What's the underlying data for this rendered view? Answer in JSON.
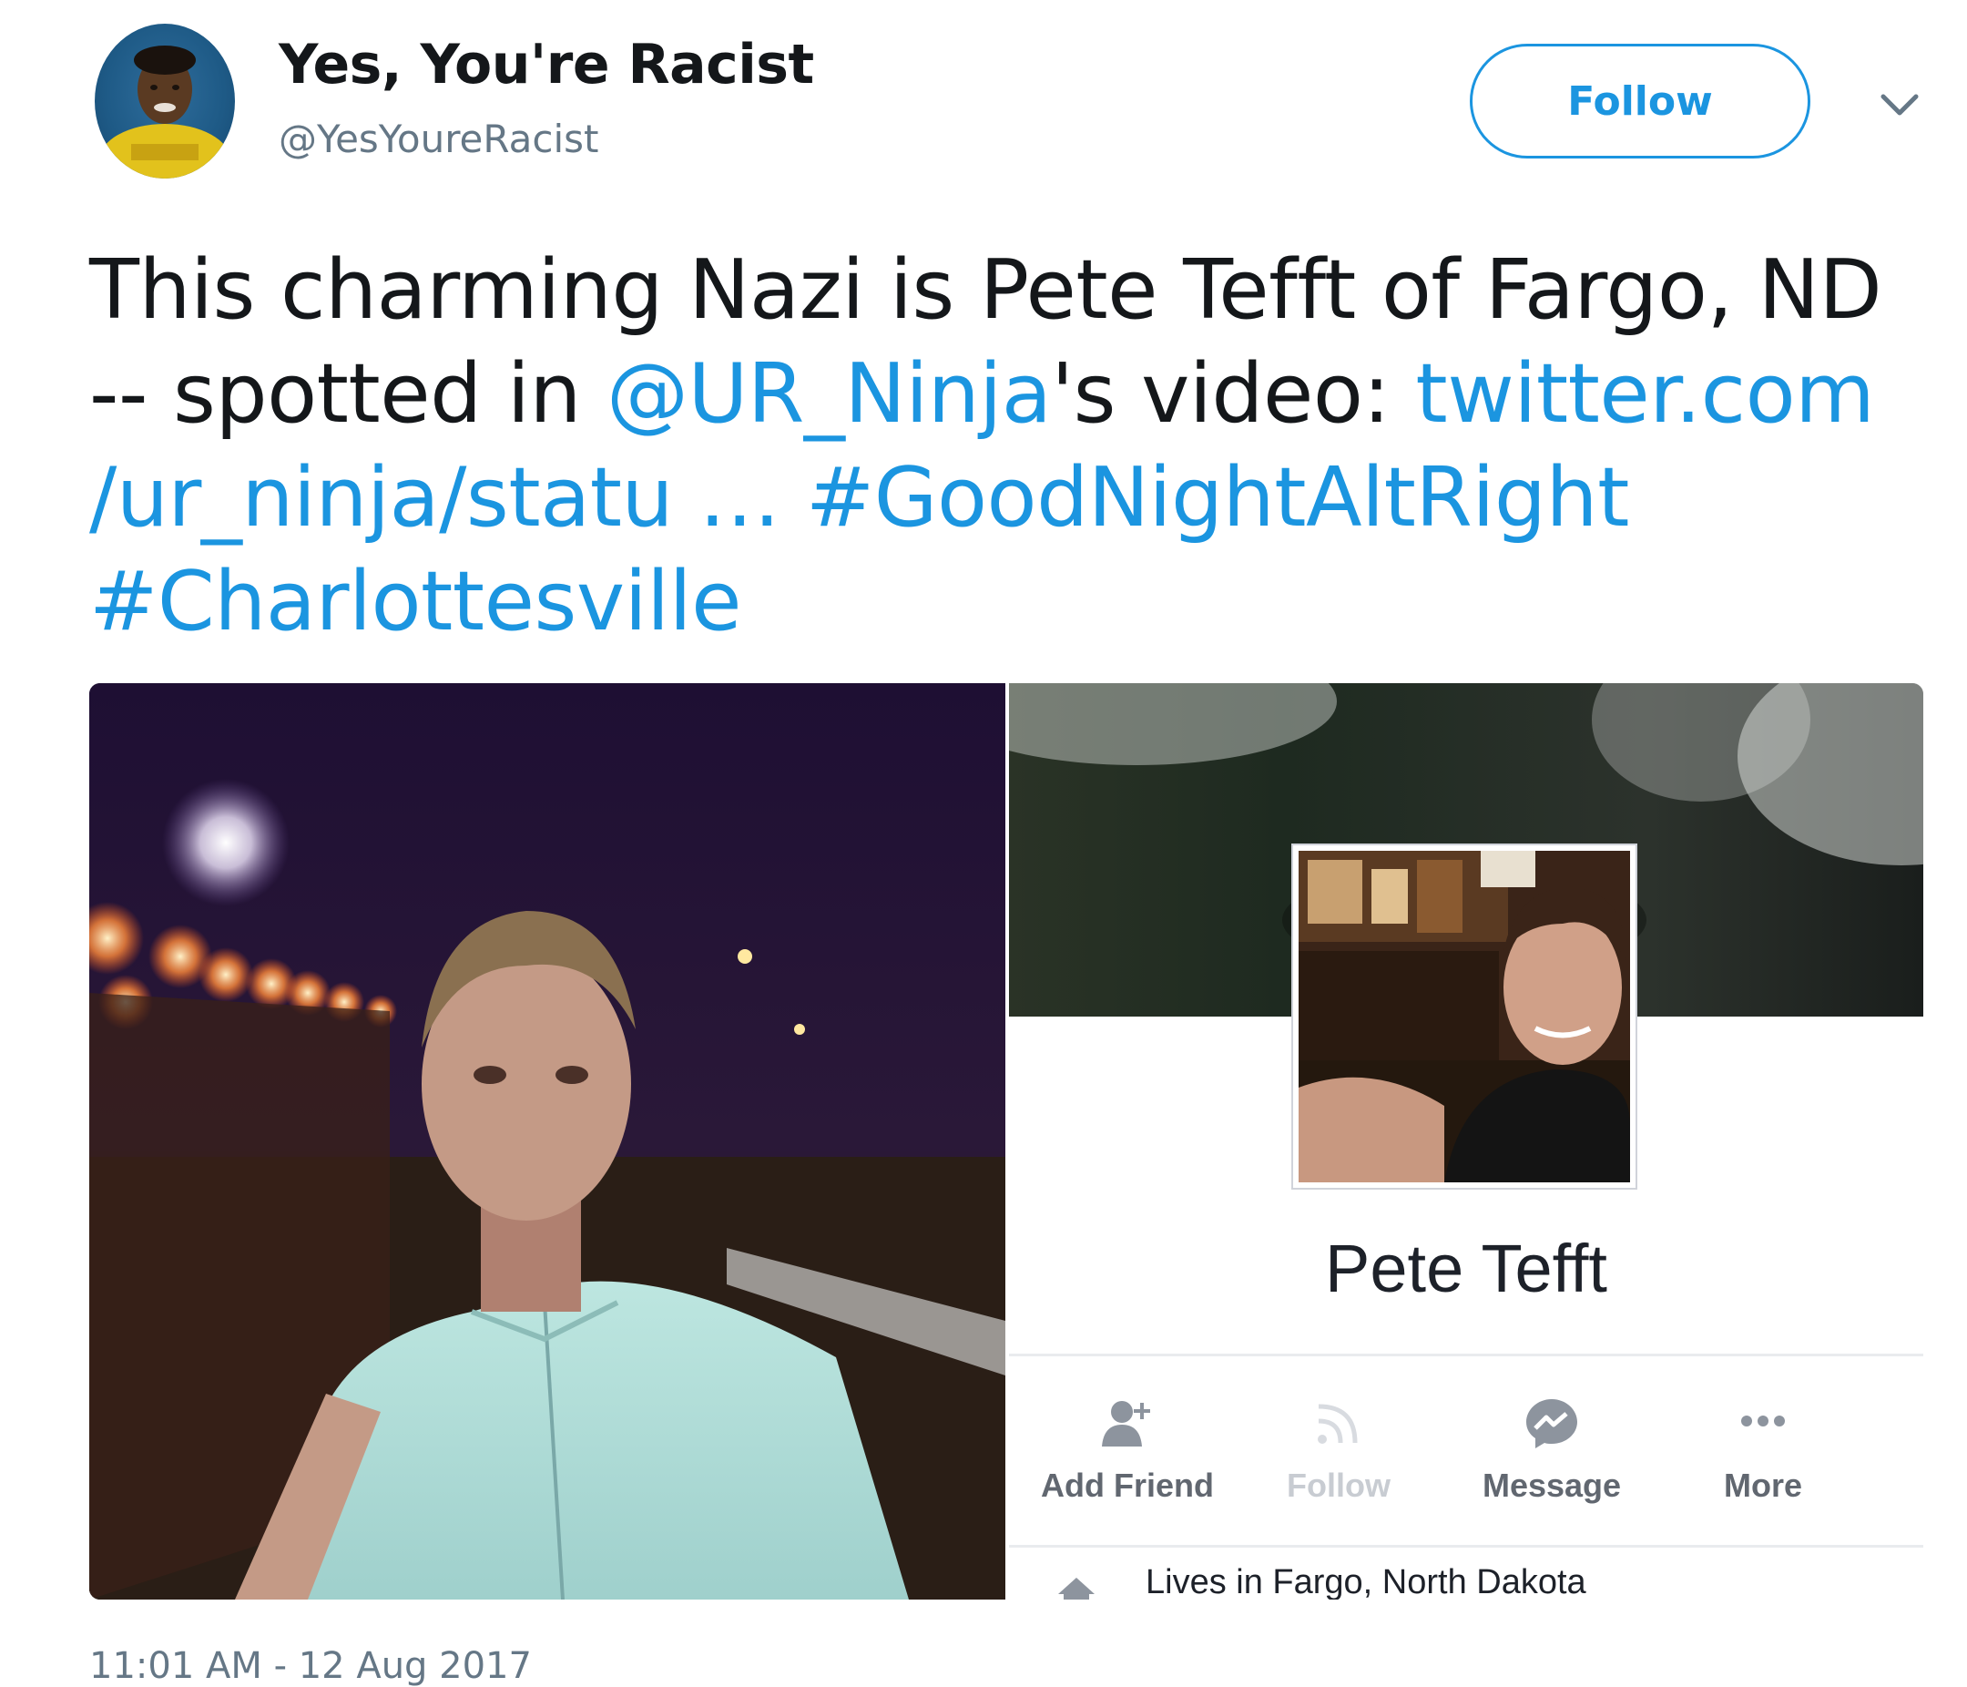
{
  "tweet": {
    "display_name": "Yes, You're Racist",
    "handle": "@YesYoureRacist",
    "follow_label": "Follow",
    "text_plain_1": "This charming Nazi is Pete Tefft of Fargo, ND -- spotted in ",
    "mention": "@UR_Ninja",
    "text_plain_2": "'s video: ",
    "url": "twitter.com /ur_ninja/statu …",
    "hashtag_1": "#GoodNightAltRight",
    "hashtag_2": "#Charlottesville",
    "timestamp": "11:01 AM - 12 Aug 2017",
    "link_color": "#1b95e0"
  },
  "fb_card": {
    "name": "Pete Tefft",
    "actions": [
      {
        "label": "Add Friend",
        "icon": "add-friend-icon",
        "enabled": true
      },
      {
        "label": "Follow",
        "icon": "rss-follow-icon",
        "enabled": false
      },
      {
        "label": "Message",
        "icon": "messenger-icon",
        "enabled": true
      },
      {
        "label": "More",
        "icon": "more-dots-icon",
        "enabled": true
      }
    ],
    "lives_in": "Lives in Fargo, North Dakota"
  }
}
